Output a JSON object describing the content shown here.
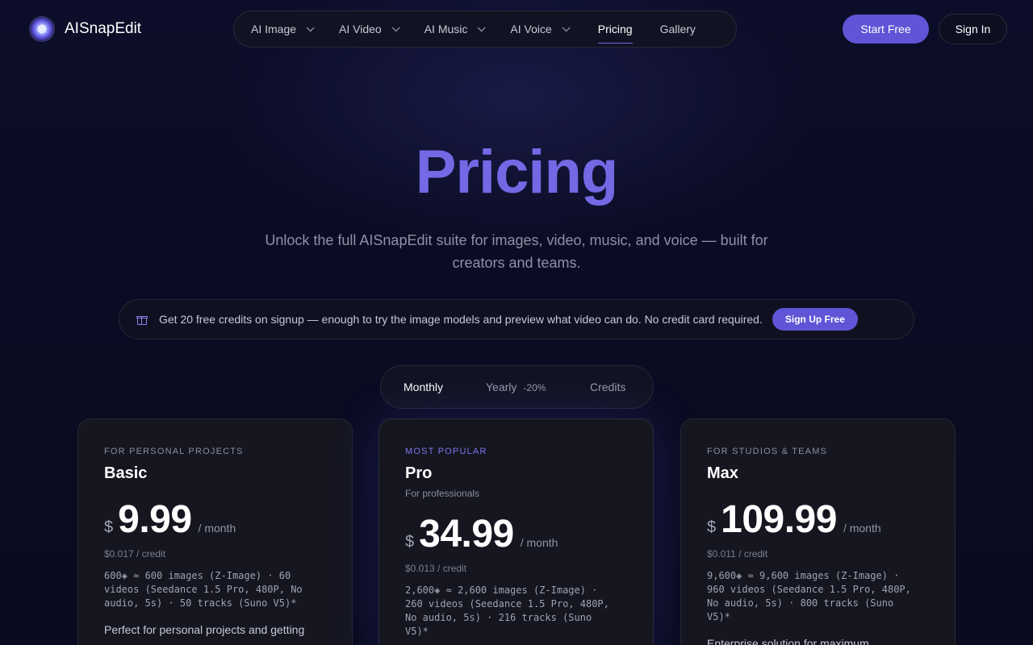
{
  "header": {
    "logo_text": "AISnapEdit",
    "nav": [
      {
        "label": "AI Image",
        "dropdown": true
      },
      {
        "label": "AI Video",
        "dropdown": true
      },
      {
        "label": "AI Music",
        "dropdown": true
      },
      {
        "label": "AI Voice",
        "dropdown": true
      },
      {
        "label": "Pricing",
        "dropdown": false,
        "active": true
      },
      {
        "label": "Gallery",
        "dropdown": false
      }
    ],
    "start_free_label": "Start Free",
    "sign_in_label": "Sign In"
  },
  "hero": {
    "title": "Pricing",
    "subtitle": "Unlock the full AISnapEdit suite for images, video, music, and voice — built for creators and teams."
  },
  "promo": {
    "icon": "gift-icon",
    "text": "Get 20 free credits on signup — enough to try the image models and preview what video can do. No credit card required.",
    "button_label": "Sign Up Free"
  },
  "billing_toggle": {
    "monthly": "Monthly",
    "yearly": "Yearly",
    "yearly_discount": "-20%",
    "credits": "Credits",
    "selected": "Monthly"
  },
  "plans": [
    {
      "eyebrow": "FOR PERSONAL PROJECTS",
      "name": "Basic",
      "subtitle": "",
      "currency": "$",
      "price": "9.99",
      "period": "/ month",
      "per_credit": "$0.017 / credit",
      "details": "600◈ ≈ 600 images (Z-Image) · 60 videos (Seedance 1.5 Pro, 480P, No audio, 5s) · 50 tracks (Suno V5)*",
      "description": "Perfect for personal projects and getting"
    },
    {
      "eyebrow": "MOST POPULAR",
      "name": "Pro",
      "subtitle": "For professionals",
      "currency": "$",
      "price": "34.99",
      "period": "/ month",
      "per_credit": "$0.013 / credit",
      "details": "2,600◈ ≈ 2,600 images (Z-Image) · 260 videos (Seedance 1.5 Pro, 480P, No audio, 5s) · 216 tracks (Suno V5)*",
      "description": ""
    },
    {
      "eyebrow": "FOR STUDIOS & TEAMS",
      "name": "Max",
      "subtitle": "",
      "currency": "$",
      "price": "109.99",
      "period": "/ month",
      "per_credit": "$0.011 / credit",
      "details": "9,600◈ ≈ 9,600 images (Z-Image) · 960 videos (Seedance 1.5 Pro, 480P, No audio, 5s) · 800 tracks (Suno V5)*",
      "description": "Enterprise solution for maximum"
    }
  ],
  "colors": {
    "accent": "#6d64e8",
    "background": "#0a0b1e",
    "card": "#151620"
  }
}
